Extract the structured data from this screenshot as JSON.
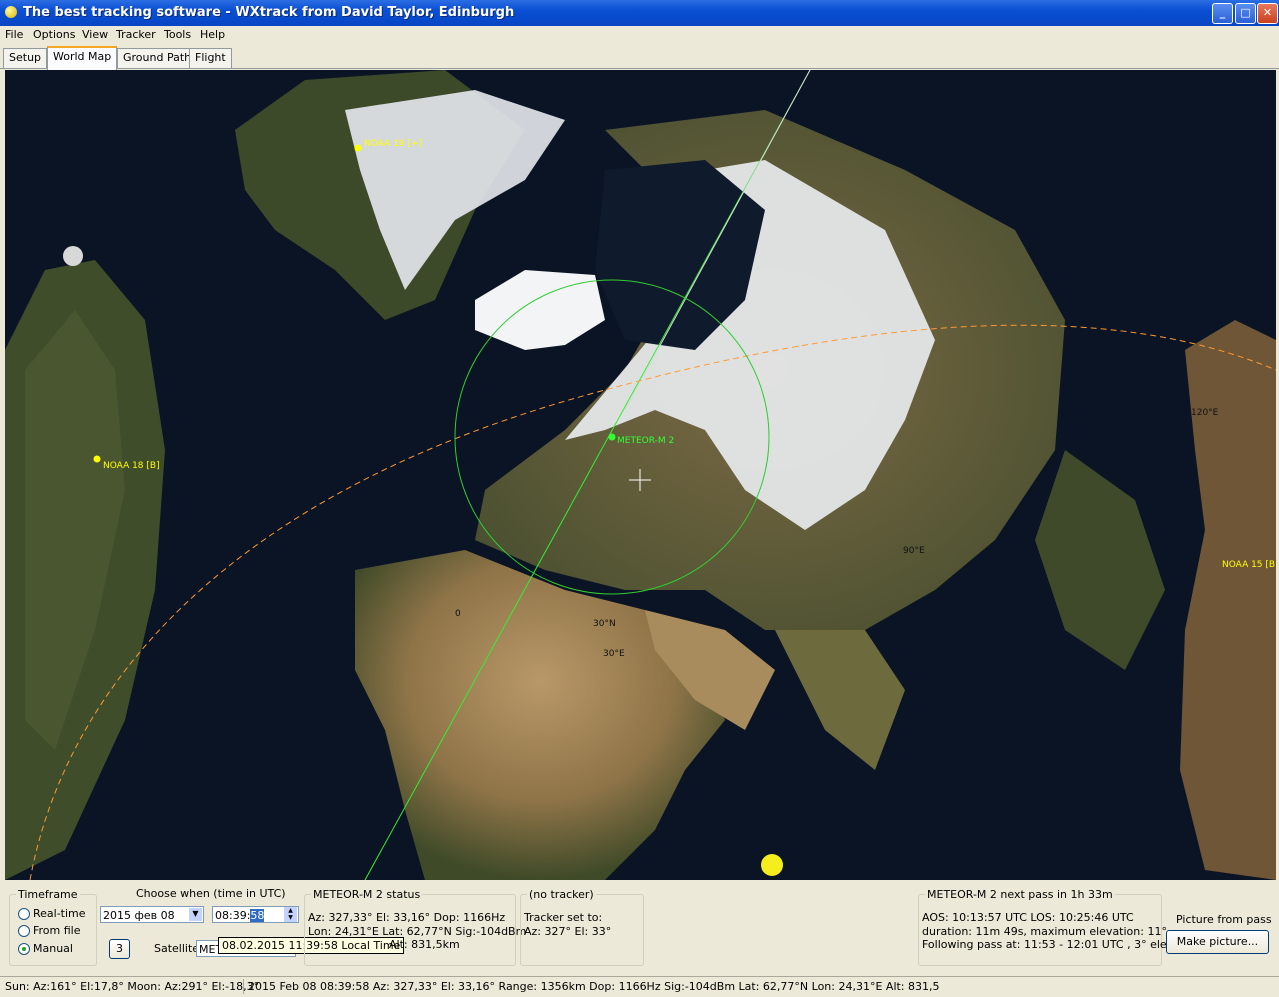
{
  "window": {
    "title": "The best tracking software - WXtrack from David Taylor, Edinburgh",
    "buttons": {
      "minimize": "_",
      "maximize": "□",
      "close": "✕"
    }
  },
  "menu": [
    "File",
    "Options",
    "View",
    "Tracker",
    "Tools",
    "Help"
  ],
  "tabs": [
    "Setup",
    "World Map",
    "Ground Path",
    "Flight"
  ],
  "map": {
    "satellites": [
      {
        "label": "NOAA 19 [+]",
        "color": "#ffff00"
      },
      {
        "label": "NOAA 18 [B]",
        "color": "#ffff00"
      },
      {
        "label": "NOAA 15 [B]",
        "color": "#ffff00"
      },
      {
        "label": "METEOR-M 2",
        "color": "#33ff33"
      }
    ],
    "grid_labels": {
      "lon0": "0",
      "lat30": "30°N",
      "lon30": "30°E",
      "lon90": "90°E",
      "lon120": "120°E"
    },
    "colors": {
      "footprint": "#33cc33",
      "track": "#33ee33",
      "terminator": "#ff9933"
    }
  },
  "timeframe": {
    "legend": "Timeframe",
    "options": [
      "Real-time",
      "From file",
      "Manual"
    ],
    "selected": "Manual"
  },
  "choose": {
    "label": "Choose when (time in UTC)",
    "date": "2015 фев 08",
    "time_prefix": "08:39:",
    "time_selected": "58",
    "step_button": "3",
    "satellite_label": "Satellite",
    "satellite_value": "MET",
    "tooltip": "08.02.2015 11:39:58  Local Time"
  },
  "status": {
    "legend": "METEOR-M 2 status",
    "line1": "Az: 327,33°  El: 33,16°  Dop: 1166Hz",
    "line2": "Lon: 24,31°E  Lat: 62,77°N  Sig:-104dBm",
    "line3": "Alt: 831,5km"
  },
  "tracker": {
    "legend": "(no tracker)",
    "line1": "Tracker set to:",
    "line2": "Az: 327°  El: 33°"
  },
  "nextpass": {
    "legend": "METEOR-M 2 next pass in 1h 33m",
    "line1": "AOS: 10:13:57 UTC  LOS: 10:25:46 UTC",
    "line2": "duration: 11m 49s,  maximum elevation: 11°",
    "line3": "Following pass at: 11:53 - 12:01 UTC , 3° elev."
  },
  "picture": {
    "label": "Picture from pass",
    "button": "Make picture..."
  },
  "statusbar": {
    "sun_moon": "Sun: Az:161° El:17,8°  Moon: Az:291° El:-18,3°",
    "details": "2015 Feb 08  08:39:58  Az: 327,33°  El: 33,16°  Range: 1356km  Dop: 1166Hz  Sig:-104dBm  Lat: 62,77°N  Lon: 24,31°E  Alt: 831,5"
  }
}
